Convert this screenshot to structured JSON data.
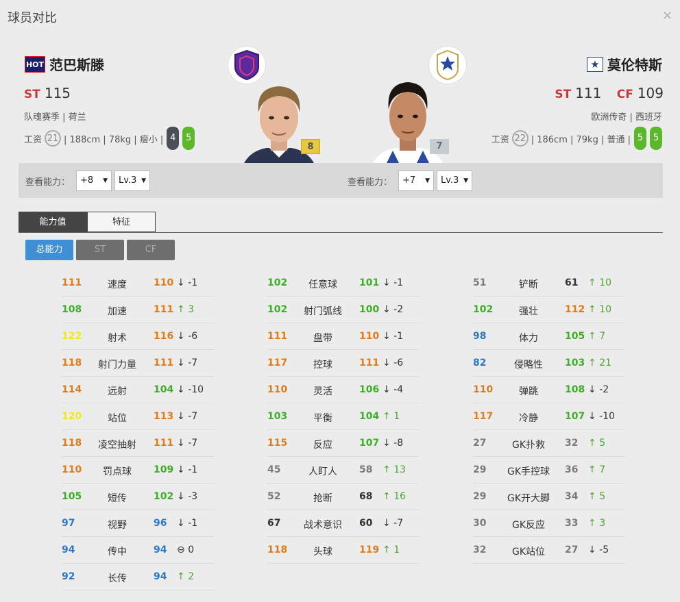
{
  "window": {
    "title": "球员对比",
    "close": "×"
  },
  "left": {
    "tag": "HOT",
    "name": "范巴斯滕",
    "pos1": "ST",
    "ovr1": "115",
    "subtitle": "队魂赛季 | 荷兰",
    "wage_label": "工资",
    "wage": "21",
    "info": "| 188cm | 78kg | 瘦小 |",
    "foot_left": "4",
    "foot_right": "5",
    "level": "8",
    "view_label": "查看能力：",
    "plus": "+8",
    "lv": "Lv.3"
  },
  "right": {
    "name": "莫伦特斯",
    "pos1": "ST",
    "ovr1": "111",
    "pos2": "CF",
    "ovr2": "109",
    "subtitle": "欧洲传奇 | 西班牙",
    "wage_label": "工资",
    "wage": "22",
    "info": "| 186cm | 79kg | 普通 |",
    "foot_left": "5",
    "foot_right": "5",
    "level": "7",
    "view_label": "查看能力：",
    "plus": "+7",
    "lv": "Lv.3"
  },
  "tabs": [
    "能力值",
    "特征"
  ],
  "subtabs": [
    "总能力",
    "ST",
    "CF"
  ],
  "colors": {
    "orange": "#e07b1a",
    "green": "#3fad2a",
    "yellow": "#f3e51a",
    "blue": "#2a78c8",
    "grey": "#7a7a7a",
    "accent": "#3e8fd6"
  },
  "stats": [
    [
      {
        "v1": "111",
        "c1": "o",
        "label": "速度",
        "v2": "110",
        "c2": "o",
        "arrow": "↓",
        "diff": "-1",
        "dir": "dn"
      },
      {
        "v1": "108",
        "c1": "g",
        "label": "加速",
        "v2": "111",
        "c2": "o",
        "arrow": "↑",
        "diff": "3",
        "dir": "up"
      },
      {
        "v1": "122",
        "c1": "y",
        "label": "射术",
        "v2": "116",
        "c2": "o",
        "arrow": "↓",
        "diff": "-6",
        "dir": "dn"
      },
      {
        "v1": "118",
        "c1": "o",
        "label": "射门力量",
        "v2": "111",
        "c2": "o",
        "arrow": "↓",
        "diff": "-7",
        "dir": "dn"
      },
      {
        "v1": "114",
        "c1": "o",
        "label": "远射",
        "v2": "104",
        "c2": "g",
        "arrow": "↓",
        "diff": "-10",
        "dir": "dn"
      },
      {
        "v1": "120",
        "c1": "y",
        "label": "站位",
        "v2": "113",
        "c2": "o",
        "arrow": "↓",
        "diff": "-7",
        "dir": "dn"
      },
      {
        "v1": "118",
        "c1": "o",
        "label": "凌空抽射",
        "v2": "111",
        "c2": "o",
        "arrow": "↓",
        "diff": "-7",
        "dir": "dn"
      },
      {
        "v1": "110",
        "c1": "o",
        "label": "罚点球",
        "v2": "109",
        "c2": "g",
        "arrow": "↓",
        "diff": "-1",
        "dir": "dn"
      },
      {
        "v1": "105",
        "c1": "g",
        "label": "短传",
        "v2": "102",
        "c2": "g",
        "arrow": "↓",
        "diff": "-3",
        "dir": "dn"
      },
      {
        "v1": "97",
        "c1": "b",
        "label": "视野",
        "v2": "96",
        "c2": "b",
        "arrow": "↓",
        "diff": "-1",
        "dir": "dn"
      },
      {
        "v1": "94",
        "c1": "b",
        "label": "传中",
        "v2": "94",
        "c2": "b",
        "arrow": "⊖",
        "diff": "0",
        "dir": "eq"
      },
      {
        "v1": "92",
        "c1": "b",
        "label": "长传",
        "v2": "94",
        "c2": "b",
        "arrow": "↑",
        "diff": "2",
        "dir": "up"
      }
    ],
    [
      {
        "v1": "102",
        "c1": "g",
        "label": "任意球",
        "v2": "101",
        "c2": "g",
        "arrow": "↓",
        "diff": "-1",
        "dir": "dn"
      },
      {
        "v1": "102",
        "c1": "g",
        "label": "射门弧线",
        "v2": "100",
        "c2": "g",
        "arrow": "↓",
        "diff": "-2",
        "dir": "dn"
      },
      {
        "v1": "111",
        "c1": "o",
        "label": "盘带",
        "v2": "110",
        "c2": "o",
        "arrow": "↓",
        "diff": "-1",
        "dir": "dn"
      },
      {
        "v1": "117",
        "c1": "o",
        "label": "控球",
        "v2": "111",
        "c2": "o",
        "arrow": "↓",
        "diff": "-6",
        "dir": "dn"
      },
      {
        "v1": "110",
        "c1": "o",
        "label": "灵活",
        "v2": "106",
        "c2": "g",
        "arrow": "↓",
        "diff": "-4",
        "dir": "dn"
      },
      {
        "v1": "103",
        "c1": "g",
        "label": "平衡",
        "v2": "104",
        "c2": "g",
        "arrow": "↑",
        "diff": "1",
        "dir": "up"
      },
      {
        "v1": "115",
        "c1": "o",
        "label": "反应",
        "v2": "107",
        "c2": "g",
        "arrow": "↓",
        "diff": "-8",
        "dir": "dn"
      },
      {
        "v1": "45",
        "c1": "gr",
        "label": "人盯人",
        "v2": "58",
        "c2": "gr",
        "arrow": "↑",
        "diff": "13",
        "dir": "up"
      },
      {
        "v1": "52",
        "c1": "gr",
        "label": "抢断",
        "v2": "68",
        "c2": "k",
        "arrow": "↑",
        "diff": "16",
        "dir": "up"
      },
      {
        "v1": "67",
        "c1": "k",
        "label": "战术意识",
        "v2": "60",
        "c2": "k",
        "arrow": "↓",
        "diff": "-7",
        "dir": "dn"
      },
      {
        "v1": "118",
        "c1": "o",
        "label": "头球",
        "v2": "119",
        "c2": "o",
        "arrow": "↑",
        "diff": "1",
        "dir": "up"
      }
    ],
    [
      {
        "v1": "51",
        "c1": "gr",
        "label": "铲断",
        "v2": "61",
        "c2": "k",
        "arrow": "↑",
        "diff": "10",
        "dir": "up"
      },
      {
        "v1": "102",
        "c1": "g",
        "label": "强壮",
        "v2": "112",
        "c2": "o",
        "arrow": "↑",
        "diff": "10",
        "dir": "up"
      },
      {
        "v1": "98",
        "c1": "b",
        "label": "体力",
        "v2": "105",
        "c2": "g",
        "arrow": "↑",
        "diff": "7",
        "dir": "up"
      },
      {
        "v1": "82",
        "c1": "bl",
        "label": "侵略性",
        "v2": "103",
        "c2": "g",
        "arrow": "↑",
        "diff": "21",
        "dir": "up"
      },
      {
        "v1": "110",
        "c1": "o",
        "label": "弹跳",
        "v2": "108",
        "c2": "g",
        "arrow": "↓",
        "diff": "-2",
        "dir": "dn"
      },
      {
        "v1": "117",
        "c1": "o",
        "label": "冷静",
        "v2": "107",
        "c2": "g",
        "arrow": "↓",
        "diff": "-10",
        "dir": "dn"
      },
      {
        "v1": "27",
        "c1": "gr",
        "label": "GK扑救",
        "v2": "32",
        "c2": "gr",
        "arrow": "↑",
        "diff": "5",
        "dir": "up"
      },
      {
        "v1": "29",
        "c1": "gr",
        "label": "GK手控球",
        "v2": "36",
        "c2": "gr",
        "arrow": "↑",
        "diff": "7",
        "dir": "up"
      },
      {
        "v1": "29",
        "c1": "gr",
        "label": "GK开大脚",
        "v2": "34",
        "c2": "gr",
        "arrow": "↑",
        "diff": "5",
        "dir": "up"
      },
      {
        "v1": "30",
        "c1": "gr",
        "label": "GK反应",
        "v2": "33",
        "c2": "gr",
        "arrow": "↑",
        "diff": "3",
        "dir": "up"
      },
      {
        "v1": "32",
        "c1": "gr",
        "label": "GK站位",
        "v2": "27",
        "c2": "gr",
        "arrow": "↓",
        "diff": "-5",
        "dir": "dn"
      }
    ]
  ]
}
